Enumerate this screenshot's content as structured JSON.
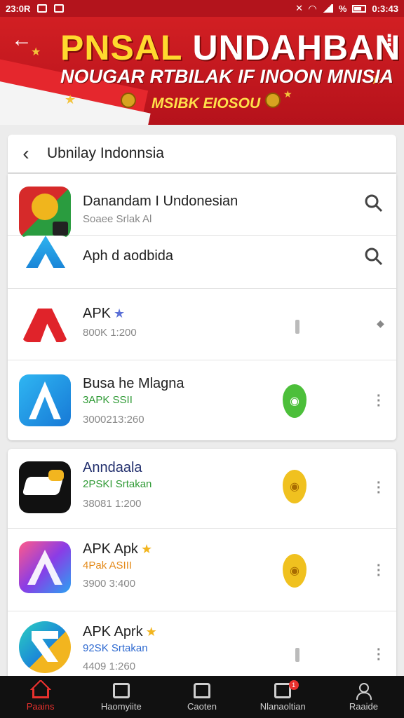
{
  "status_bar": {
    "time_left": "23:0R",
    "time_right": "0:3:43",
    "battery_text": "%"
  },
  "banner": {
    "title_yellow": "PNSAL",
    "title_white": "UNDAHBAN",
    "subtitle": "NOUGAR RTBILAK IF INOON MNISIA",
    "tagline": "MSIBK EIOSOU"
  },
  "header": {
    "title": "Ubnilay Indonnsia"
  },
  "apps": [
    {
      "name": "Danandam I Undonesian",
      "sub": "Soaee Srlak Al",
      "meta": ""
    },
    {
      "name": "Aph d aodbida",
      "sub": "",
      "meta": ""
    },
    {
      "name": "APK",
      "sub": "800K 1:200",
      "meta": ""
    },
    {
      "name": "Busa he Mlagna",
      "sub": "3APK  SSII",
      "meta": "3000213:260"
    },
    {
      "name": "Anndaala",
      "sub": "2PSKI  Srtakan",
      "meta": "38081 1:200"
    },
    {
      "name": "APK Apk",
      "sub": "4Pak  ASIII",
      "meta": "3900 3:400"
    },
    {
      "name": "APK Aprk",
      "sub": "92SK  Srtakan",
      "meta": "4409 1:260"
    }
  ],
  "bottom_nav": [
    {
      "label": "Paains",
      "active": true
    },
    {
      "label": "Haomyiite",
      "active": false
    },
    {
      "label": "Caoten",
      "active": false
    },
    {
      "label": "Nlanaoltian",
      "active": false,
      "badge": "1"
    },
    {
      "label": "Raaide",
      "active": false
    }
  ],
  "colors": {
    "accent": "#e8312e",
    "banner_red": "#c8181f",
    "banner_yellow": "#ffd92e",
    "nav_bg": "#111111"
  }
}
